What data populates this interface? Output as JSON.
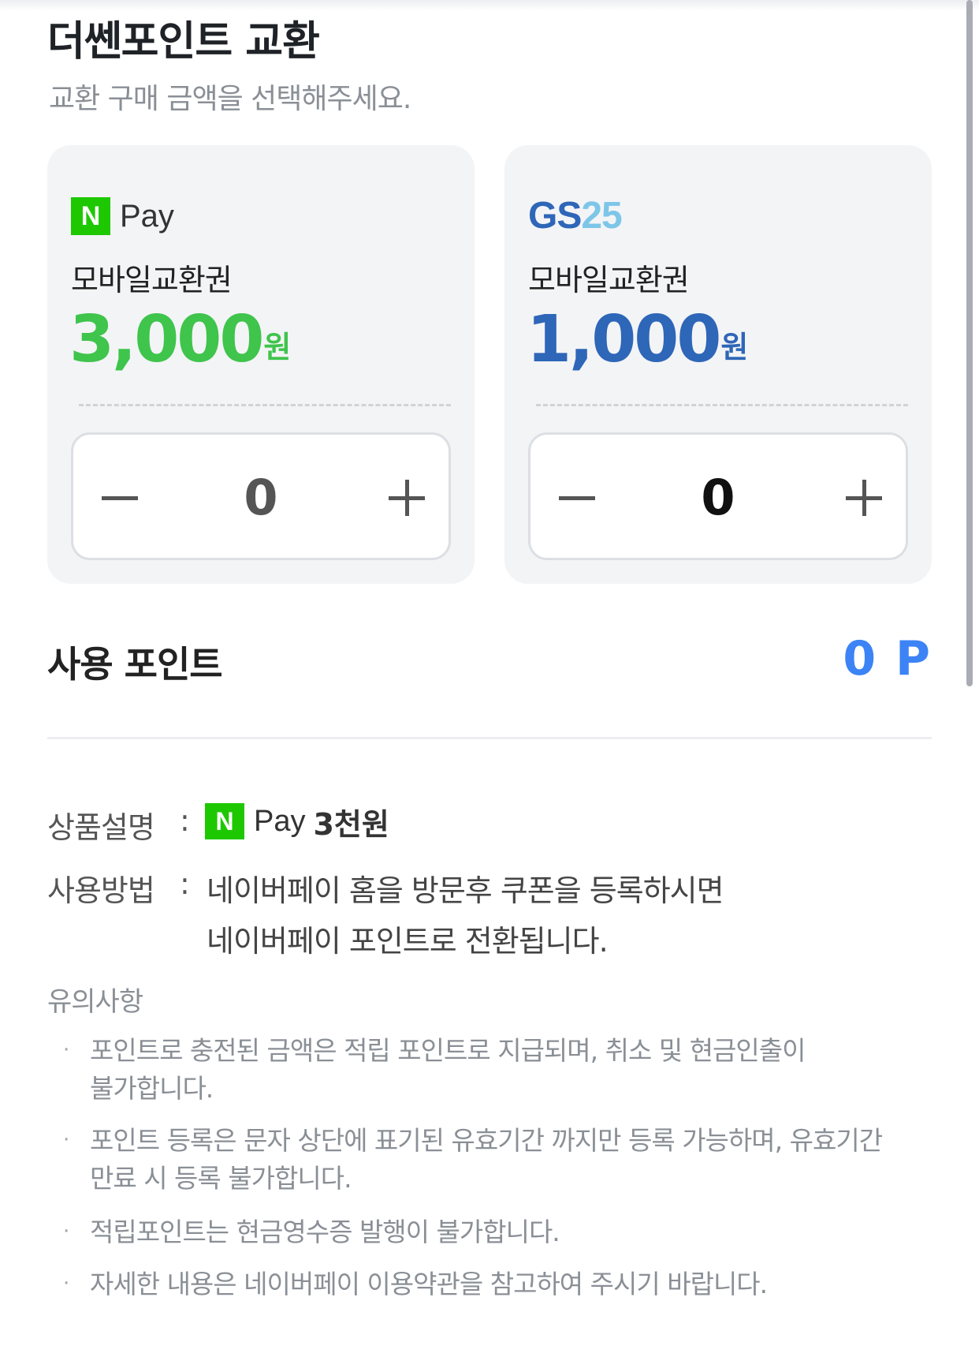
{
  "header": {
    "title": "더쎈포인트 교환",
    "subtitle": "교환 구매 금액을 선택해주세요."
  },
  "cards": [
    {
      "brand": "npay",
      "brand_box": "N",
      "brand_text": "Pay",
      "name": "모바일교환권",
      "amount": "3,000",
      "unit": "원",
      "accent": "#3fc44c",
      "quantity": "0"
    },
    {
      "brand": "gs25",
      "brand_gs": "GS",
      "brand_25": "25",
      "name": "모바일교환권",
      "amount": "1,000",
      "unit": "원",
      "accent": "#2e66b8",
      "quantity": "0"
    }
  ],
  "icons": {
    "minus": "minus-icon",
    "plus": "plus-icon"
  },
  "usage": {
    "label": "사용 포인트",
    "value": "0 P",
    "color": "#3c83f5"
  },
  "description": {
    "product_label": "상품설명",
    "colon": ":",
    "product_box": "N",
    "product_pay": "Pay",
    "product_name": "3천원",
    "howto_label": "사용방법",
    "howto_line1": "네이버페이 홈을 방문후 쿠폰을 등록하시면",
    "howto_line2": "네이버페이 포인트로 전환됩니다."
  },
  "notes": {
    "title": "유의사항",
    "bullet": "·",
    "items": [
      [
        "포인트로 충전된 금액은 적립 포인트로 지급되며, 취소 및 현금인출이",
        "불가합니다."
      ],
      [
        "포인트 등록은 문자 상단에 표기된 유효기간 까지만 등록 가능하며, 유효기간",
        "만료 시 등록 불가합니다."
      ],
      [
        "적립포인트는 현금영수증 발행이 불가합니다."
      ],
      [
        "자세한 내용은 네이버페이 이용약관을 참고하여 주시기 바랍니다."
      ]
    ]
  }
}
